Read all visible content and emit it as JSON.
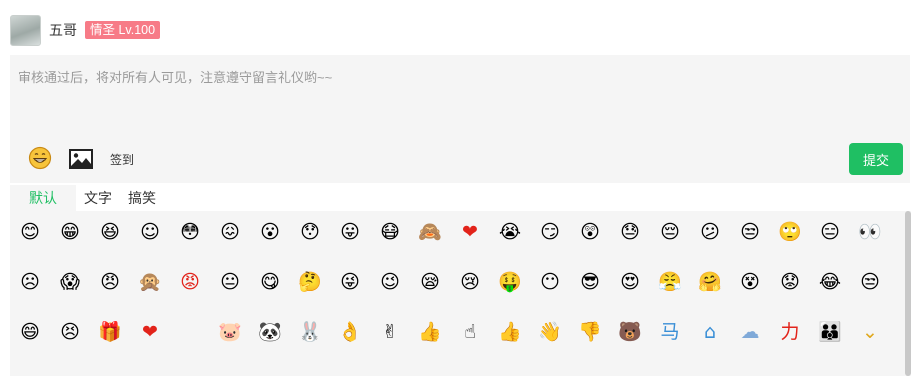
{
  "user": {
    "name": "五哥",
    "badge": "情圣 Lv.100"
  },
  "editor": {
    "placeholder": "审核通过后，将对所有人可见，注意遵守留言礼仪哟~~",
    "value": ""
  },
  "toolbar": {
    "smile_icon": "grin-emoji-icon",
    "image_icon": "image-icon",
    "checkin_label": "签到",
    "submit_label": "提交"
  },
  "tabs": [
    {
      "label": "默认",
      "active": true
    },
    {
      "label": "文字",
      "active": false
    },
    {
      "label": "搞笑",
      "active": false
    }
  ],
  "colors": {
    "accent": "#1fbf63",
    "badge": "#f77b87",
    "panel": "#f5f5f5"
  },
  "emoji_rows": [
    [
      "smile",
      "grin",
      "laugh",
      "blush",
      "shy",
      "awkward",
      "yawn",
      "stare",
      "tongue",
      "sick",
      "cover-face",
      "heart-face",
      "cry",
      "giggle",
      "shout",
      "sweat",
      "sad",
      "confused",
      "smirk",
      "sly",
      "pout",
      "eye-monster"
    ],
    [
      "frown",
      "shock",
      "angry",
      "hands-cover",
      "red-angry",
      "meh",
      "lick",
      "think",
      "wink-tongue",
      "slant",
      "sleepy",
      "weep",
      "money",
      "silent",
      "cool",
      "heart-eyes",
      "angry-face",
      "hug",
      "dizzy",
      "worried",
      "cry-laugh",
      "side-eye"
    ],
    [
      "happy-laugh",
      "annoyed",
      "gift-bag",
      "red-heart",
      "",
      "pig",
      "panda",
      "rabbit",
      "ok-hand",
      "victory",
      "thumbs-up",
      "finger-point",
      "thumb-small",
      "come-here",
      "thumbs-down",
      "bear",
      "horse-sign",
      "house-sign",
      "cloud",
      "power",
      "group",
      "chevron-down"
    ]
  ]
}
